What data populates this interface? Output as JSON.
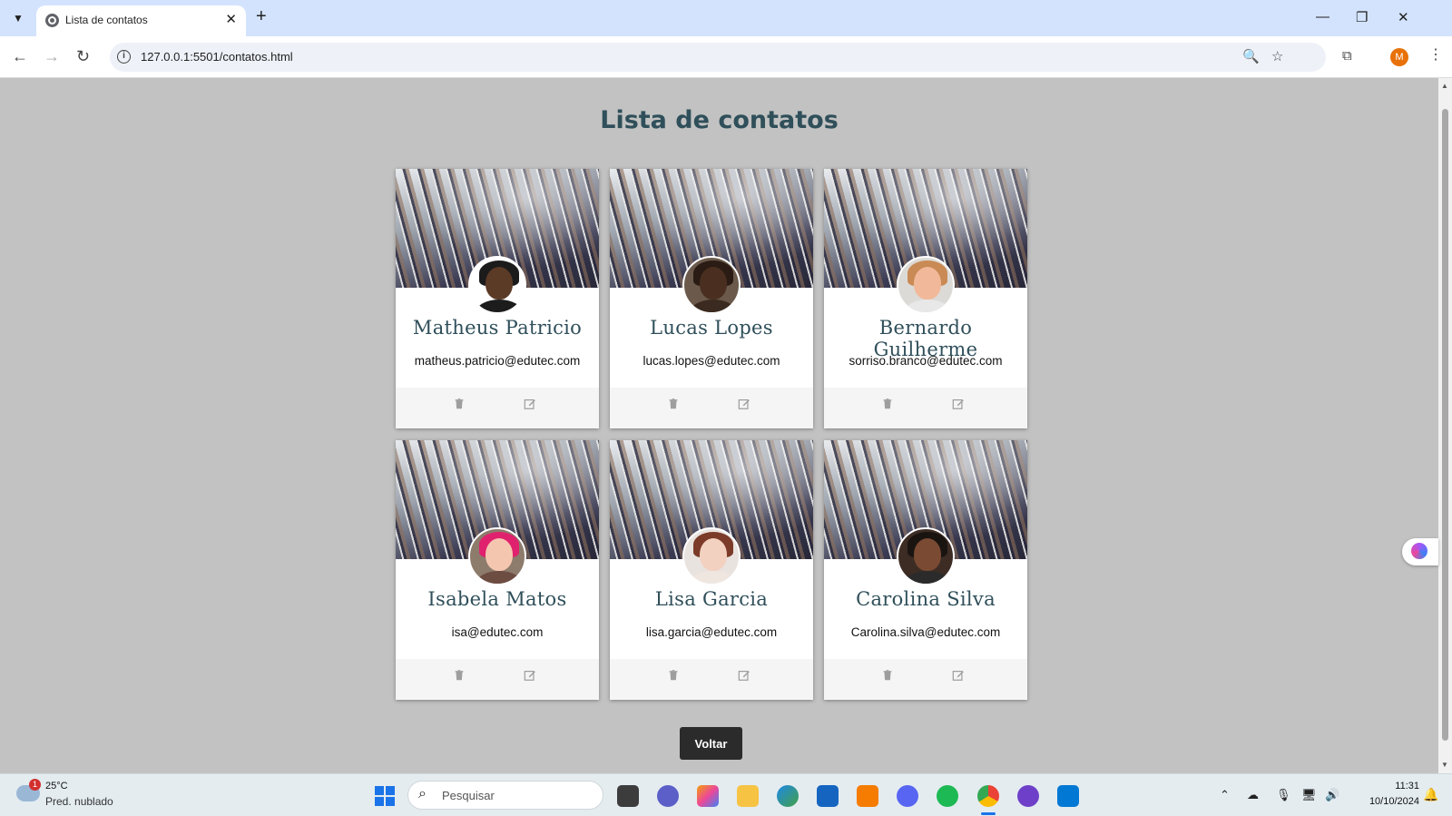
{
  "browser": {
    "tab_title": "Lista de contatos",
    "url": "127.0.0.1:5501/contatos.html",
    "profile_initial": "M"
  },
  "page": {
    "title": "Lista de contatos",
    "back_button": "Voltar"
  },
  "contacts": [
    {
      "name": "Matheus Patricio",
      "email": "matheus.patricio@edutec.com",
      "avatar": {
        "skin": "#5b3a26",
        "hair": "#1b1b1b",
        "body": "#1c1c1c",
        "bg": "#ffffff"
      }
    },
    {
      "name": "Lucas Lopes",
      "email": "lucas.lopes@edutec.com",
      "avatar": {
        "skin": "#4a2f20",
        "hair": "#2a1c14",
        "body": "#3b2a20",
        "bg": "#6b5a4c"
      }
    },
    {
      "name": "Bernardo Guilherme",
      "email": "sorriso.branco@edutec.com",
      "avatar": {
        "skin": "#f2b89a",
        "hair": "#c98a55",
        "body": "#e8e8e8",
        "bg": "#dcdad6"
      }
    },
    {
      "name": "Isabela Matos",
      "email": "isa@edutec.com",
      "avatar": {
        "skin": "#f4c6b0",
        "hair": "#e0226e",
        "body": "#6d4c41",
        "bg": "#8d7b6b"
      }
    },
    {
      "name": "Lisa Garcia",
      "email": "lisa.garcia@edutec.com",
      "avatar": {
        "skin": "#f3d1c1",
        "hair": "#7b3b28",
        "body": "#f0e6e0",
        "bg": "#e9e3df"
      }
    },
    {
      "name": "Carolina Silva",
      "email": "Carolina.silva@edutec.com",
      "avatar": {
        "skin": "#7a4a32",
        "hair": "#1a1411",
        "body": "#2b2b2b",
        "bg": "#3c2c24"
      }
    }
  ],
  "taskbar": {
    "weather_temp": "25°C",
    "weather_desc": "Pred. nublado",
    "weather_badge": "1",
    "search_placeholder": "Pesquisar",
    "time": "11:31",
    "date": "10/10/2024"
  }
}
